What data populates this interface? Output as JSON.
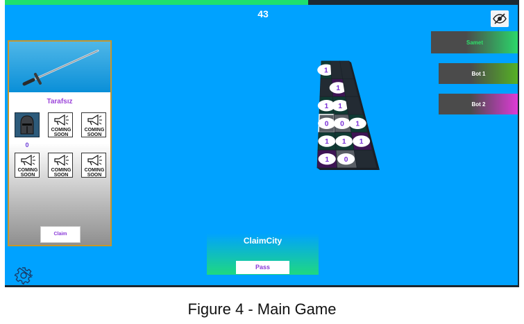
{
  "timer": {
    "value": "43",
    "progress": 0.59
  },
  "hide_button": {
    "icon": "eye-slash-icon"
  },
  "left_panel": {
    "faction_name": "Tarafsız",
    "weapon": "sword-icon",
    "slots": [
      {
        "type": "helmet",
        "icon": "helmet-icon",
        "count": "0"
      },
      {
        "type": "coming",
        "line1": "COMING",
        "line2": "SOON",
        "icon": "megaphone-icon"
      },
      {
        "type": "coming",
        "line1": "COMING",
        "line2": "SOON",
        "icon": "megaphone-icon"
      },
      {
        "type": "coming",
        "line1": "COMING",
        "line2": "SOON",
        "icon": "megaphone-icon"
      },
      {
        "type": "coming",
        "line1": "COMING",
        "line2": "SOON",
        "icon": "megaphone-icon"
      },
      {
        "type": "coming",
        "line1": "COMING",
        "line2": "SOON",
        "icon": "megaphone-icon"
      }
    ],
    "claim_label": "Claim"
  },
  "players": [
    {
      "name": "Samet",
      "color": "#2ad86a"
    },
    {
      "name": "Bot 1",
      "color": "#55b324"
    },
    {
      "name": "Bot 2",
      "color": "#e03ad8"
    }
  ],
  "action_panel": {
    "title": "ClaimCity",
    "pass_label": "Pass"
  },
  "board": {
    "rows": 6,
    "cols": 3,
    "tiles": [
      [
        {
          "value": "1",
          "owner": "green"
        },
        {
          "value": null,
          "owner": "none"
        },
        {
          "value": null,
          "owner": "none"
        }
      ],
      [
        {
          "value": null,
          "owner": "none"
        },
        {
          "value": "1",
          "owner": "purple"
        },
        {
          "value": null,
          "owner": "none"
        }
      ],
      [
        {
          "value": "1",
          "owner": "green"
        },
        {
          "value": "1",
          "owner": "green"
        },
        {
          "value": null,
          "owner": "none"
        }
      ],
      [
        {
          "value": "0",
          "owner": "neutral",
          "selected": true
        },
        {
          "value": "0",
          "owner": "neutral"
        },
        {
          "value": "1",
          "owner": "green"
        }
      ],
      [
        {
          "value": "1",
          "owner": "green"
        },
        {
          "value": "1",
          "owner": "green"
        },
        {
          "value": "1",
          "owner": "purple"
        }
      ],
      [
        {
          "value": "1",
          "owner": "purple"
        },
        {
          "value": "0",
          "owner": "neutral"
        },
        {
          "value": null,
          "owner": "none"
        }
      ]
    ]
  },
  "settings": {
    "icon": "gear-icon"
  },
  "caption": "Figure 4 - Main Game"
}
